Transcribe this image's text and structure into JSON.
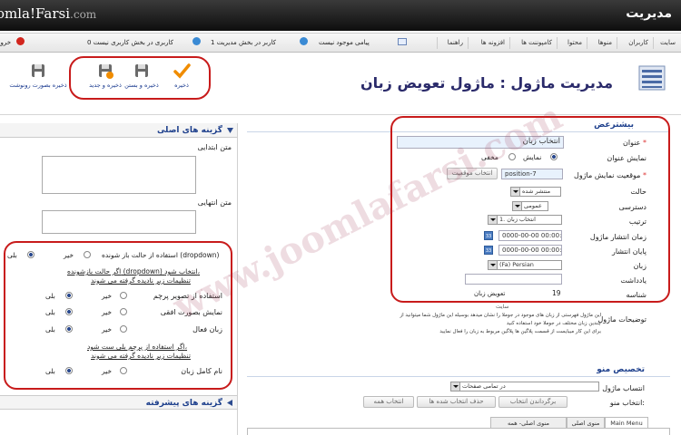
{
  "header": {
    "logo_main": "omla",
    "logo_brand": "!Farsi",
    "logo_tld": ".com",
    "title": "مدیریت"
  },
  "menubar": {
    "items": [
      "سایت",
      "کاربران",
      "منوها",
      "محتوا",
      "کامپوننت ها",
      "افزونه ها",
      "راهنما"
    ],
    "status_messages": "پیامی موجود نیست",
    "status_admins": "1 کاربر در بخش مدیریت",
    "status_users": "0 کاربری در بخش کاربری نیست",
    "logout": "خروج"
  },
  "toolbar": {
    "page_title": "مدیریت ماژول : ماژول تعویض زبان",
    "buttons": [
      {
        "label": "ذخیره",
        "icon": "checkmark-icon"
      },
      {
        "label": "ذخیره و بستن",
        "icon": "save-close-icon"
      },
      {
        "label": "ذخیره و جدید",
        "icon": "save-new-icon"
      },
      {
        "label": "ذخیره بصورت رونوشت",
        "icon": "save-copy-icon"
      }
    ]
  },
  "details": {
    "section_title": "بیشترعض",
    "title_label": "عنوان",
    "title_value": "انتخاب زبان",
    "show_title_label": "نمایش عنوان",
    "show_option": "نمایش",
    "hide_option": "مخفی",
    "position_label": "موقعیت نمایش ماژول",
    "position_value": "position-7",
    "select_position_btn": "انتخاب موقعیت",
    "status_label": "حالت",
    "status_value": "منتشر شده",
    "access_label": "دسترسی",
    "access_value": "عمومی",
    "ordering_label": "ترتیب",
    "ordering_value": "1. انتخاب زبان",
    "publish_up_label": "زمان انتشار ماژول",
    "publish_up_value": "0000-00-00 00:00:00",
    "publish_down_label": "پایان انتشار",
    "publish_down_value": "0000-00-00 00:00:00",
    "language_label": "زبان",
    "language_value": "(Fa) Persian",
    "note_label": "یادداشت",
    "id_label": "شناسه",
    "id_value": "19",
    "id_text": "تعویض زبان",
    "description_label": "توضیحات ماژول",
    "site_label": "سایت",
    "description_lines": [
      "این ماژول فهرستی از زبان های موجود در جوملا را نشان میدهد بوسیله این ماژول شما میتوانید از",
      "چندین زبان مختلف در جوملا خود استفاده کنید",
      "برای این کار میبایست از قسمت پلاگین ها پلاگین مربوط به زبان را فعال نمایید"
    ]
  },
  "menu_assignment": {
    "section_title": "تخصیص منو",
    "assignment_label": "انتساب ماژول",
    "assignment_value": "در تمامی صفحات",
    "menu_select_label": "انتخاب منو:",
    "btn_toggle": "برگرداندن انتخاب",
    "btn_clear": "حذف انتخاب شده ها",
    "btn_all": "انتخاب همه",
    "tabs": [
      "Main Menu",
      "منوی اصلی",
      "منوی اصلی- همه"
    ]
  },
  "options": {
    "basic_title": "گزینه های اصلی",
    "pre_text_label": "متن ابتدایی",
    "post_text_label": "متن انتهایی",
    "dropdown_label": "استفاده از حالت باز شونده (dropdown)",
    "dropdown_note_1": "اگر حالت بازشونده (dropdown) انتخاب شود،",
    "dropdown_note_2": "تنظیمات زیر نادیده گرفته می شوند",
    "use_images_label": "استفاده از تصویر پرچم",
    "horizontal_label": "نمایش بصورت افقی",
    "active_label": "زبان فعال",
    "flags_note_1": "اگر استفاده از پرچم بلی ست شود،",
    "flags_note_2": "تنظیمات زیر نادیده گرفته می شوند",
    "full_name_label": "نام کامل زبان",
    "yes": "بلی",
    "no": "خیر",
    "advanced_title": "گزینه های پیشرفته"
  },
  "watermark": "www.joomlafarsi.com"
}
